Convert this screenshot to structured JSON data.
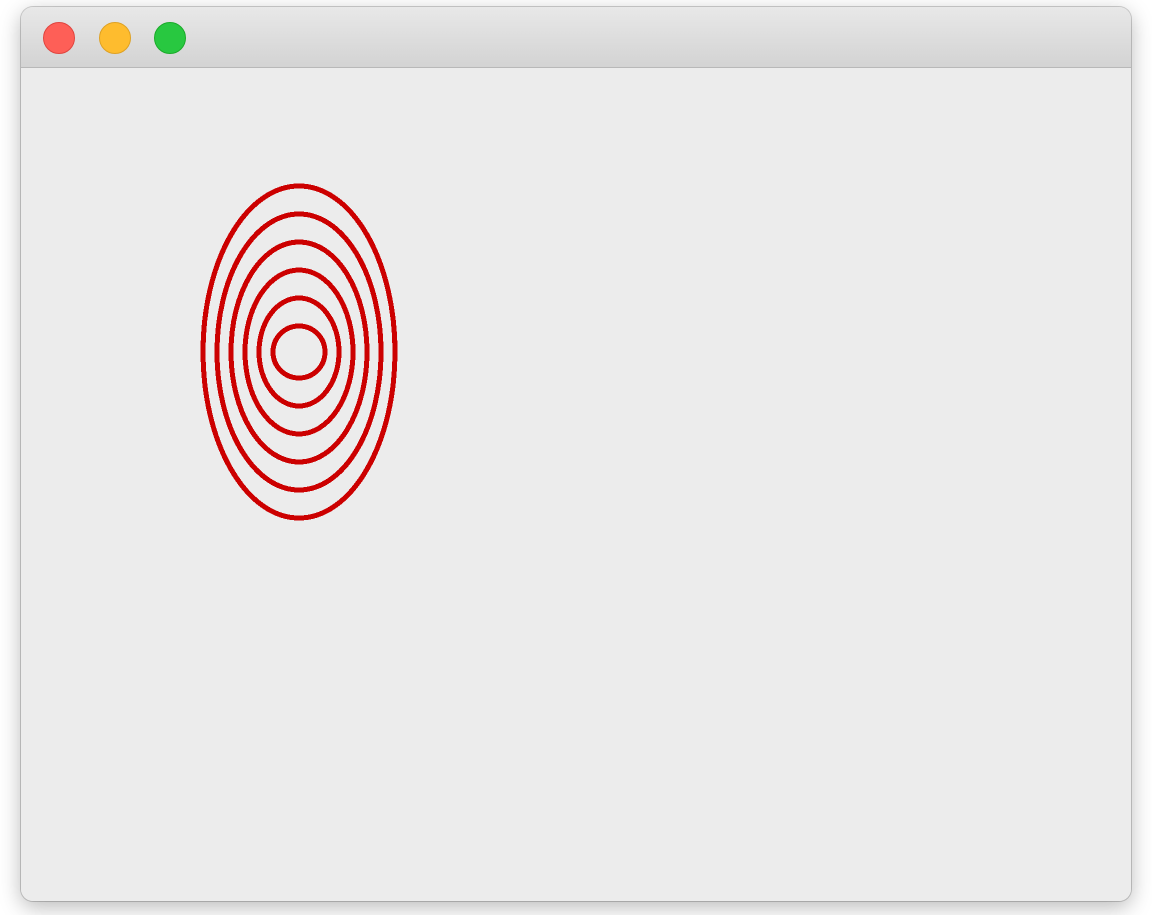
{
  "window": {
    "title": "",
    "controls": {
      "close": {
        "icon": "close-icon",
        "color": "#fe5f57",
        "border": "#e0443e"
      },
      "minimize": {
        "icon": "minimize-icon",
        "color": "#febc2e",
        "border": "#dea123"
      },
      "zoom": {
        "icon": "zoom-icon",
        "color": "#28c840",
        "border": "#1aab29"
      }
    }
  },
  "canvas": {
    "background": "#ececec",
    "rings": {
      "count": 6,
      "stroke_color": "#cc0000"
    }
  }
}
